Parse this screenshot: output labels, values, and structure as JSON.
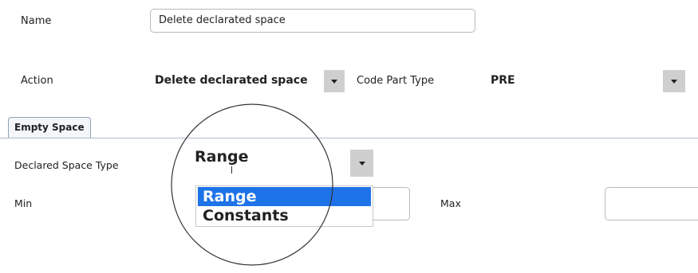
{
  "form": {
    "name_label": "Name",
    "name_value": "Delete declarated space",
    "action_label": "Action",
    "action_value": "Delete declarated space",
    "code_part_type_label": "Code Part Type",
    "code_part_type_value": "PRE"
  },
  "tab": {
    "label": "Empty Space"
  },
  "empty_space": {
    "declared_space_type_label": "Declared Space Type",
    "declared_space_type_value": "Range",
    "options": [
      "Range",
      "Constants"
    ],
    "selected_option": "Range",
    "min_label": "Min",
    "max_label": "Max",
    "min_value": "",
    "max_value": ""
  },
  "icons": {
    "dropdown": "chevron-down-icon"
  },
  "colors": {
    "selection": "#1e73e8",
    "button": "#cfcfcf",
    "tab_border": "#8ea2b8"
  }
}
